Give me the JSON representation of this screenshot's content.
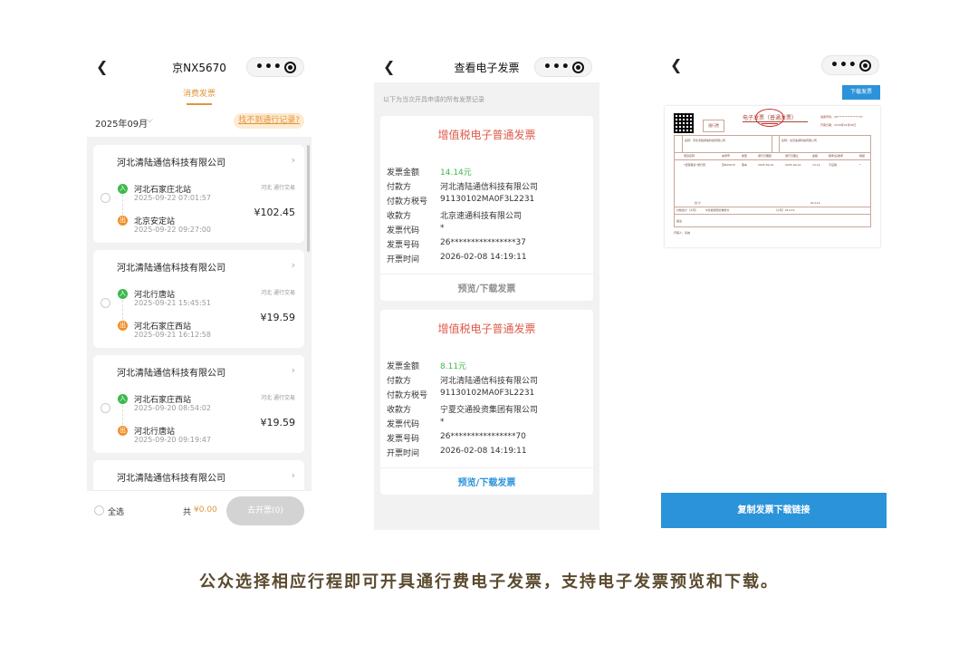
{
  "colors": {
    "orange": "#e0953a",
    "green": "#3cb84b",
    "red": "#e05a4a",
    "blue": "#2b93d9",
    "caption": "#5a4a2e"
  },
  "icons": {
    "back": "chevron-left-icon",
    "more": "more-dots-icon",
    "close": "target-circle-icon"
  },
  "phone1": {
    "title": "京NX5670",
    "tab": "消费发票",
    "month": "2025年09月",
    "not_found": "找不到通行记录?",
    "trips": [
      {
        "company": "河北清陆通信科技有限公司",
        "tag": "河北 通行交易",
        "start_station": "河北石家庄北站",
        "start_time": "2025-09-22 07:01:57",
        "end_station": "北京安定站",
        "end_time": "2025-09-22 09:27:00",
        "amount": "¥102.45",
        "start_badge": "入",
        "end_badge": "出"
      },
      {
        "company": "河北清陆通信科技有限公司",
        "tag": "河北 通行交易",
        "start_station": "河北行唐站",
        "start_time": "2025-09-21 15:45:51",
        "end_station": "河北石家庄西站",
        "end_time": "2025-09-21 16:12:58",
        "amount": "¥19.59",
        "start_badge": "入",
        "end_badge": "出"
      },
      {
        "company": "河北清陆通信科技有限公司",
        "tag": "河北 通行交易",
        "start_station": "河北石家庄西站",
        "start_time": "2025-09-20 08:54:02",
        "end_station": "河北行唐站",
        "end_time": "2025-09-20 09:19:47",
        "amount": "¥19.59",
        "start_badge": "入",
        "end_badge": "出"
      },
      {
        "company": "河北清陆通信科技有限公司"
      }
    ],
    "select_all": "全选",
    "total_label": "共",
    "total_value": "¥0.00",
    "issue_button": "去开票(0)"
  },
  "phone2": {
    "title": "查看电子发票",
    "hint": "以下为当次开具申请的所有发票记录",
    "labels": [
      "发票金额",
      "付款方",
      "付款方税号",
      "收款方",
      "发票代码",
      "发票号码",
      "开票时间"
    ],
    "invoices": [
      {
        "title": "增值税电子普通发票",
        "values": [
          "14.14元",
          "河北清陆通信科技有限公司",
          "91130102MA0F3L2231",
          "北京速通科技有限公司",
          "*",
          "26****************37",
          "2026-02-08 14:19:11"
        ],
        "action": "预览/下载发票"
      },
      {
        "title": "增值税电子普通发票",
        "values": [
          "8.11元",
          "河北清陆通信科技有限公司",
          "91130102MA0F3L2231",
          "宁夏交通投资集团有限公司",
          "*",
          "26****************70",
          "2026-02-08 14:19:11"
        ],
        "action": "预览/下载发票"
      }
    ]
  },
  "phone3": {
    "download_button": "下载发票",
    "copy_button": "复制发票下载链接",
    "doc": {
      "title": "电子发票（普通发票）",
      "qr_label": "通行费",
      "meta": [
        "发票号码：26****************37",
        "开票日期：2026年02月08日"
      ],
      "headers": [
        "项目名称",
        "车牌号",
        "类型",
        "通行日期起",
        "通行日期止",
        "金额",
        "税率/征收率",
        "税额"
      ],
      "row": [
        "*经营租赁*通行费",
        "京NX5670",
        "客车",
        "2025-09-22",
        "2025-09-22",
        "14.14",
        "不征税",
        "*"
      ],
      "total_label": "合 计",
      "total_value": "¥14.14",
      "words_label": "价税合计（大写）",
      "words_value": "⊗壹拾肆圆壹角肆分",
      "words_small": "（小写）¥14.14",
      "remark": "备注",
      "buyer": "名称：河北清陆通信科技有限公司",
      "seller": "名称：北京速通科技有限公司",
      "issuer": "开票人：系统"
    }
  },
  "caption": "公众选择相应行程即可开具通行费电子发票，支持电子发票预览和下载。"
}
